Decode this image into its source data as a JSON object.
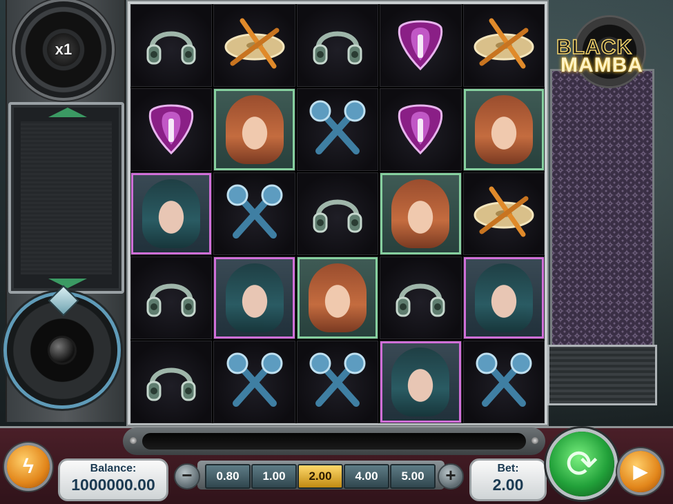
{
  "game": {
    "logo_line1": "BLACK",
    "logo_line2": "MAMBA",
    "multiplier": "x1"
  },
  "reels": [
    [
      "headphones-icon",
      "guitar-pick-icon",
      "portrait-dark-hair",
      "headphones-icon",
      "headphones-icon"
    ],
    [
      "cymbal-drumsticks-icon",
      "portrait-red-hair",
      "microphones-icon",
      "portrait-dark-hair",
      "microphones-icon"
    ],
    [
      "headphones-icon",
      "microphones-icon",
      "headphones-icon",
      "portrait-red-hair",
      "microphones-icon"
    ],
    [
      "guitar-pick-icon",
      "guitar-pick-icon",
      "portrait-red-hair",
      "headphones-icon",
      "portrait-dark-hair"
    ],
    [
      "cymbal-drumsticks-icon",
      "portrait-red-hair",
      "cymbal-drumsticks-icon",
      "portrait-dark-hair",
      "microphones-icon"
    ]
  ],
  "controls": {
    "balance_label": "Balance:",
    "balance_value": "1000000.00",
    "bet_label": "Bet:",
    "bet_value": "2.00",
    "decrease": "−",
    "increase": "+",
    "bet_options": [
      "0.80",
      "1.00",
      "2.00",
      "4.00",
      "5.00"
    ],
    "selected_bet": "2.00",
    "quick_icon": "lightning-icon",
    "spin_icon": "spin-arrows-icon",
    "autoplay_icon": "autoplay-icon"
  },
  "colors": {
    "accent_green": "#22a13a",
    "accent_orange": "#e2861b",
    "selected_chip": "#ffd86a",
    "portrait_dark_border": "#d06fd8",
    "portrait_red_border": "#86d09f"
  }
}
